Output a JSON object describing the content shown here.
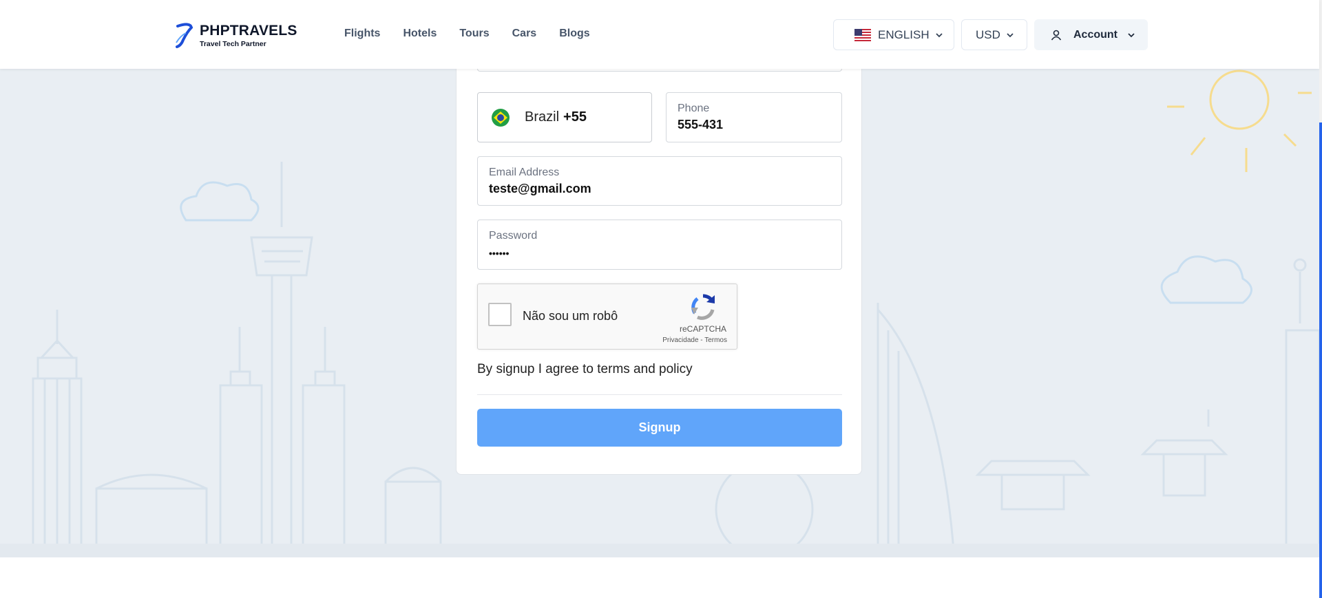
{
  "header": {
    "brand_title": "PHPTRAVELS",
    "brand_subtitle": "Travel Tech Partner",
    "nav": [
      "Flights",
      "Hotels",
      "Tours",
      "Cars",
      "Blogs"
    ],
    "language": "ENGLISH",
    "currency": "USD",
    "account": "Account"
  },
  "form": {
    "country_name": "Brazil",
    "country_code": "+55",
    "phone_label": "Phone",
    "phone_value": "555-431",
    "email_label": "Email Address",
    "email_value": "teste@gmail.com",
    "password_label": "Password",
    "password_value": "••••••",
    "recaptcha_label": "Não sou um robô",
    "recaptcha_brand": "reCAPTCHA",
    "recaptcha_links": "Privacidade - Termos",
    "terms_text": "By signup I agree to terms and policy",
    "signup_label": "Signup"
  },
  "colors": {
    "accent": "#60a5fa",
    "scroll": "#2563eb",
    "background": "#e9eef3"
  },
  "icons": [
    "logo-icon",
    "us-flag-icon",
    "chevron-down-icon",
    "user-icon",
    "brazil-flag-icon",
    "recaptcha-logo-icon"
  ]
}
